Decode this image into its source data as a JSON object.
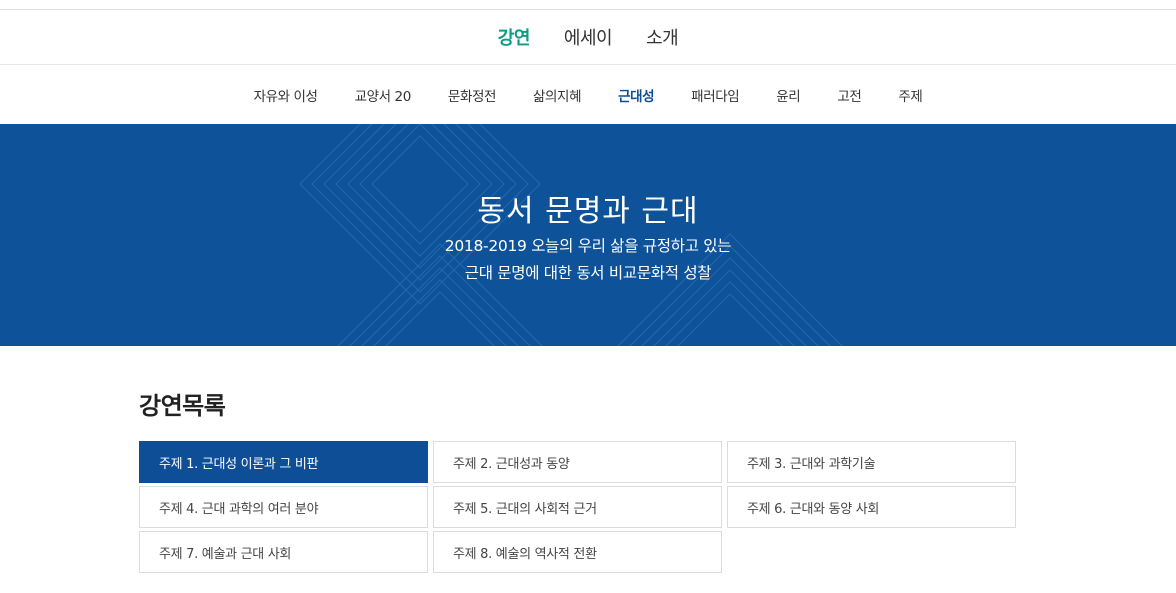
{
  "main_nav": {
    "items": [
      {
        "label": "강연",
        "active": true
      },
      {
        "label": "에세이",
        "active": false
      },
      {
        "label": "소개",
        "active": false
      }
    ]
  },
  "sub_nav": {
    "items": [
      {
        "label": "자유와 이성",
        "active": false
      },
      {
        "label": "교양서 20",
        "active": false
      },
      {
        "label": "문화정전",
        "active": false
      },
      {
        "label": "삶의지혜",
        "active": false
      },
      {
        "label": "근대성",
        "active": true
      },
      {
        "label": "패러다임",
        "active": false
      },
      {
        "label": "윤리",
        "active": false
      },
      {
        "label": "고전",
        "active": false
      },
      {
        "label": "주제",
        "active": false
      }
    ]
  },
  "banner": {
    "title": "동서 문명과 근대",
    "subtitle_line1": "2018-2019 오늘의 우리 삶을 규정하고 있는",
    "subtitle_line2": "근대 문명에 대한 동서 비교문화적 성찰",
    "background_color": "#0e5299"
  },
  "lectures": {
    "heading": "강연목록",
    "items": [
      {
        "label": "주제 1. 근대성 이론과 그 비판",
        "active": true
      },
      {
        "label": "주제 2. 근대성과 동양",
        "active": false
      },
      {
        "label": "주제 3. 근대와 과학기술",
        "active": false
      },
      {
        "label": "주제 4. 근대 과학의 여러 분야",
        "active": false
      },
      {
        "label": "주제 5. 근대의 사회적 근거",
        "active": false
      },
      {
        "label": "주제 6. 근대와 동양 사회",
        "active": false
      },
      {
        "label": "주제 7. 예술과 근대 사회",
        "active": false
      },
      {
        "label": "주제 8. 예술의 역사적 전환",
        "active": false
      }
    ]
  },
  "colors": {
    "accent_green": "#0f9c84",
    "accent_blue": "#0e4e96"
  }
}
